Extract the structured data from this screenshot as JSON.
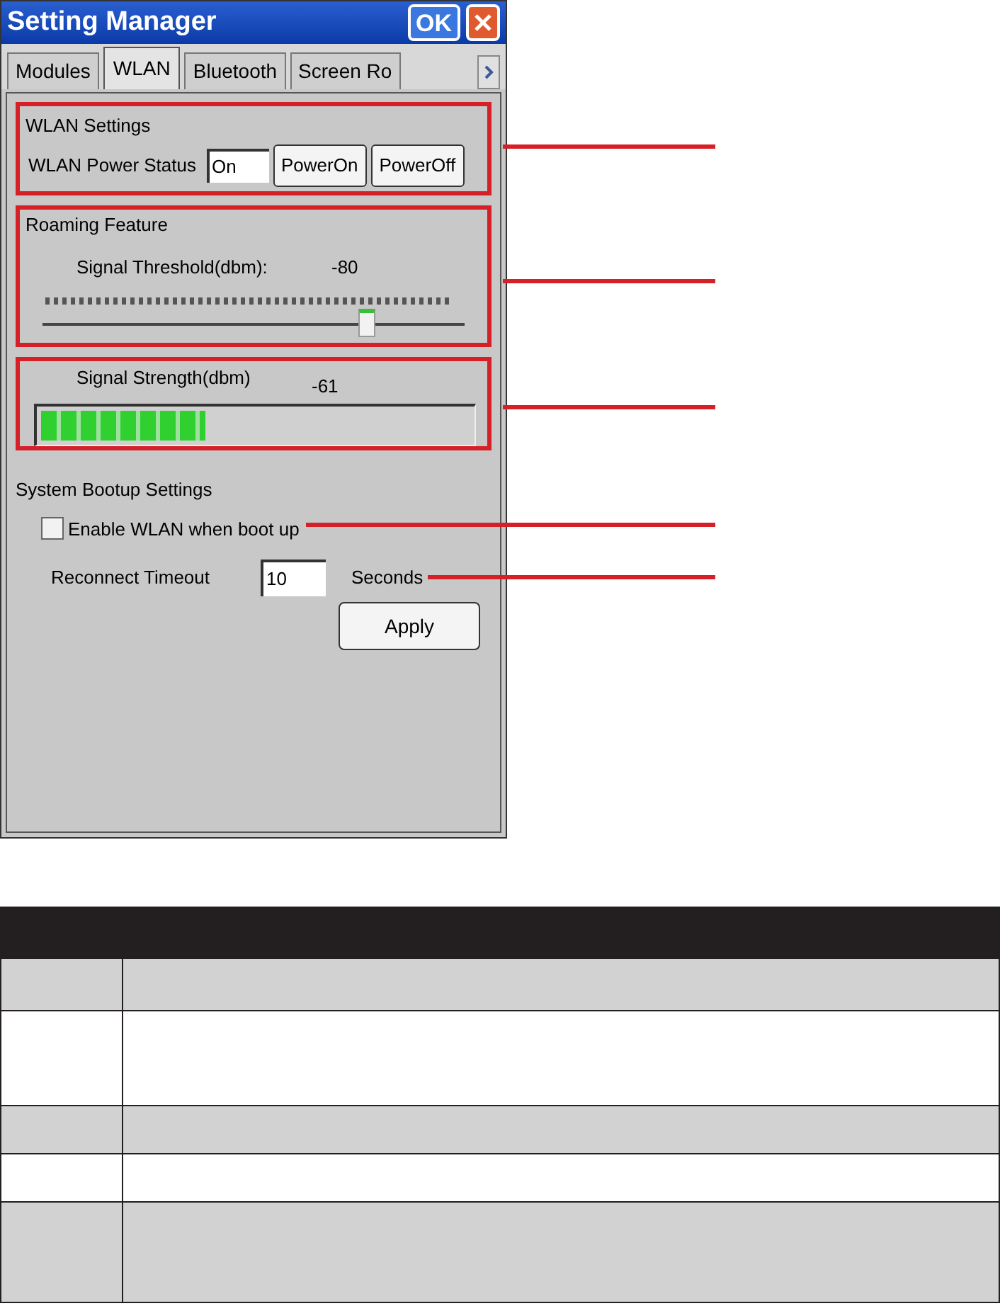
{
  "window": {
    "title": "Setting Manager",
    "ok_button": "OK"
  },
  "tabs": [
    {
      "label": "Modules",
      "selected": false
    },
    {
      "label": "WLAN",
      "selected": true
    },
    {
      "label": "Bluetooth",
      "selected": false
    },
    {
      "label": "Screen Ro",
      "selected": false
    }
  ],
  "wlan_settings": {
    "title": "WLAN Settings",
    "power_status_label": "WLAN Power Status",
    "power_status_value": "On",
    "buttons": [
      "PowerOn",
      "PowerOff"
    ]
  },
  "roaming": {
    "title": "Roaming Feature",
    "threshold_label": "Signal Threshold(dbm):",
    "threshold_value": "-80",
    "threshold_slider": {
      "level": 0.77
    }
  },
  "signal": {
    "label": "Signal Strength(dbm)",
    "value": "-61",
    "level": 0.38
  },
  "bootup": {
    "title": "System Bootup Settings",
    "enable_wlan": {
      "label": "Enable WLAN when boot up",
      "checked": false
    },
    "timeout_label": "Reconnect Timeout",
    "timeout_value": "10",
    "timeout_unit": "Seconds",
    "apply_button": "Apply"
  }
}
